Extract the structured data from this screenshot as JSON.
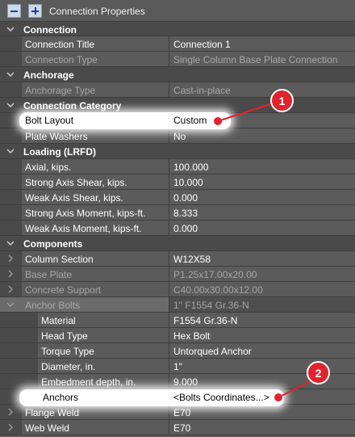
{
  "panel": {
    "title": "Connection Properties",
    "collapse_icon": "minus-icon",
    "expand_icon": "plus-icon"
  },
  "categories": {
    "connection": "Connection",
    "anchorage": "Anchorage",
    "connection_category": "Connection Category",
    "loading": "Loading (LRFD)",
    "components": "Components"
  },
  "connection": {
    "title_label": "Connection Title",
    "title_value": "Connection 1",
    "type_label": "Connection Type",
    "type_value": "Single Column Base Plate Connection"
  },
  "anchorage": {
    "type_label": "Anchorage Type",
    "type_value": "Cast-in-place"
  },
  "connection_category": {
    "bolt_layout_label": "Bolt Layout",
    "bolt_layout_value": "Custom",
    "plate_washers_label": "Plate Washers",
    "plate_washers_value": "No"
  },
  "loading": {
    "axial_label": "Axial, kips.",
    "axial_value": "100.000",
    "strong_shear_label": "Strong Axis Shear, kips.",
    "strong_shear_value": "10.000",
    "weak_shear_label": "Weak Axis Shear, kips.",
    "weak_shear_value": "0.000",
    "strong_moment_label": "Strong Axis Moment, kips-ft.",
    "strong_moment_value": "8.333",
    "weak_moment_label": "Weak Axis Moment, kips-ft.",
    "weak_moment_value": "0.000"
  },
  "components": {
    "column_section_label": "Column Section",
    "column_section_value": "W12X58",
    "base_plate_label": "Base Plate",
    "base_plate_value": "P1.25x17.00x20.00",
    "concrete_support_label": "Concrete Support",
    "concrete_support_value": "C40.00x30.00x12.00",
    "anchor_bolts_label": "Anchor Bolts",
    "anchor_bolts_value": "1\" F1554 Gr.36-N",
    "material_label": "Material",
    "material_value": "F1554 Gr.36-N",
    "head_type_label": "Head Type",
    "head_type_value": "Hex Bolt",
    "torque_type_label": "Torque Type",
    "torque_type_value": "Untorqued Anchor",
    "diameter_label": "Diameter, in.",
    "diameter_value": "1\"",
    "embedment_label": "Embedment depth, in.",
    "embedment_value": "9.000",
    "anchors_label": "Anchors",
    "anchors_value": "<Bolts Coordinates...>",
    "flange_weld_label": "Flange Weld",
    "flange_weld_value": "E70",
    "web_weld_label": "Web Weld",
    "web_weld_value": "E70"
  },
  "callouts": {
    "badge_1": "1",
    "badge_2": "2",
    "color": "#e0232e"
  }
}
